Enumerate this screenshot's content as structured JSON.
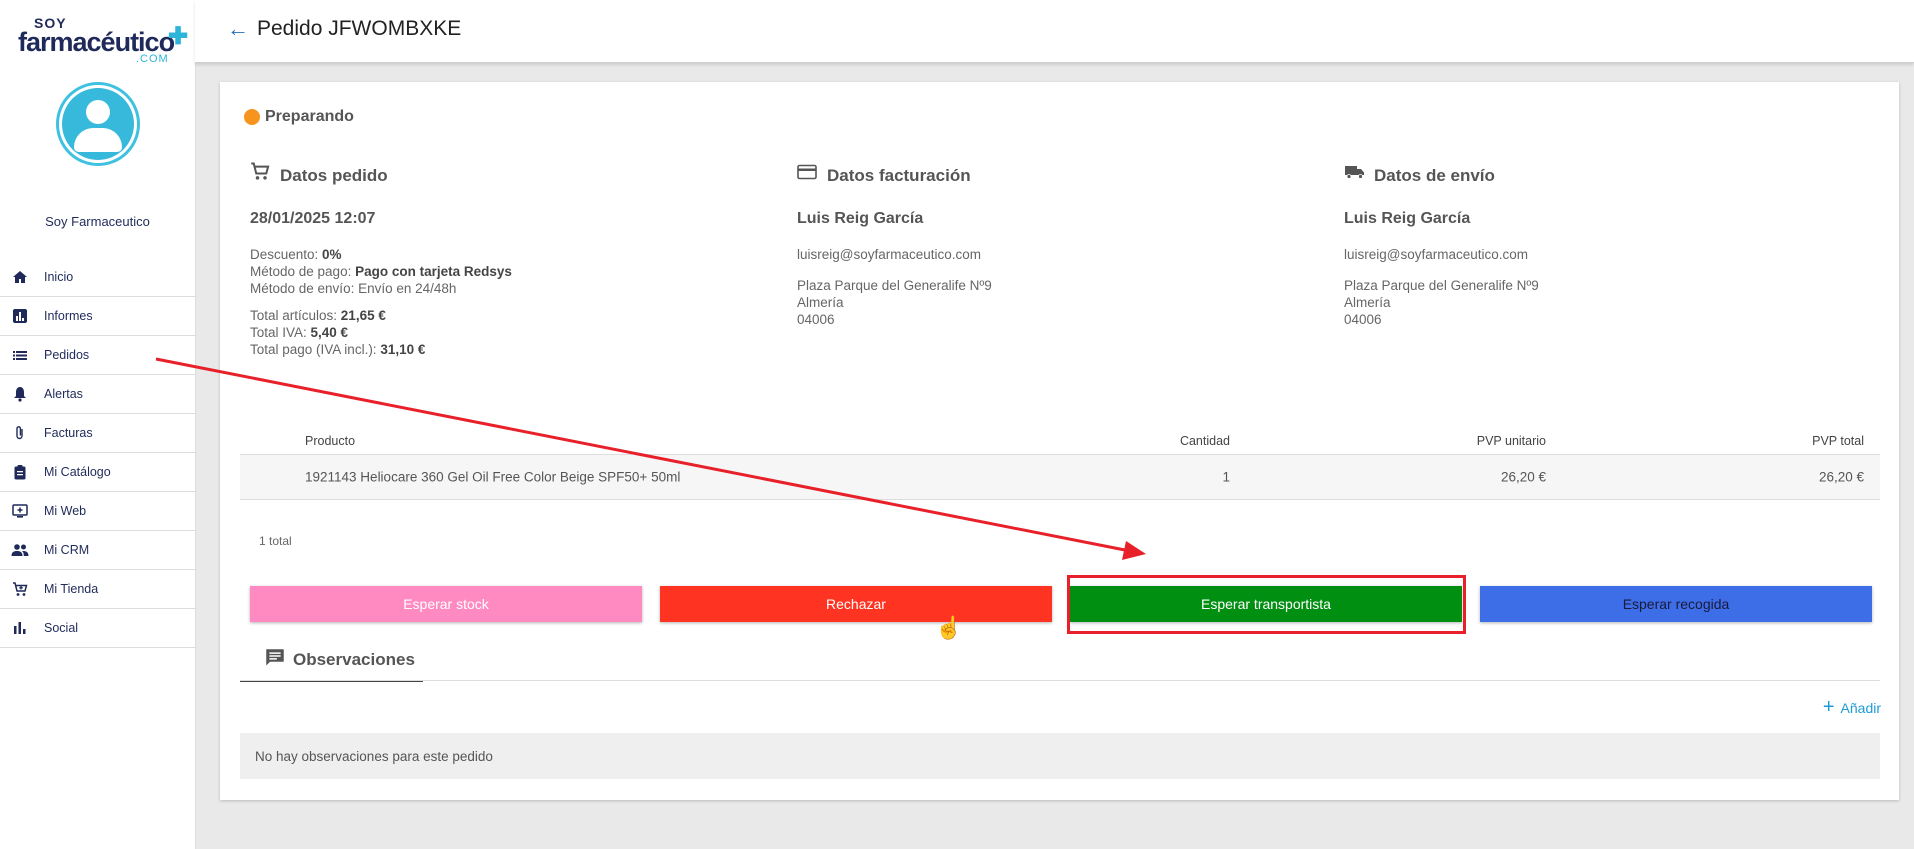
{
  "logo": {
    "line1": "SOY",
    "line2": "farmacéutico",
    "line3": ".COM"
  },
  "user": {
    "name": "Soy Farmaceutico"
  },
  "nav": {
    "items": [
      {
        "label": "Inicio",
        "icon": "home-icon"
      },
      {
        "label": "Informes",
        "icon": "chart-icon"
      },
      {
        "label": "Pedidos",
        "icon": "list-icon"
      },
      {
        "label": "Alertas",
        "icon": "bell-icon"
      },
      {
        "label": "Facturas",
        "icon": "paperclip-icon"
      },
      {
        "label": "Mi Catálogo",
        "icon": "clipboard-icon"
      },
      {
        "label": "Mi Web",
        "icon": "monitor-icon"
      },
      {
        "label": "Mi CRM",
        "icon": "people-icon"
      },
      {
        "label": "Mi Tienda",
        "icon": "cart-icon"
      },
      {
        "label": "Social",
        "icon": "bar-chart-icon"
      }
    ]
  },
  "header": {
    "title": "Pedido JFWOMBXKE"
  },
  "order": {
    "status": "Preparando",
    "status_color": "#f7941d",
    "datos_pedido": {
      "title": "Datos pedido",
      "date": "28/01/2025 12:07",
      "descuento_label": "Descuento: ",
      "descuento": "0%",
      "pago_label": "Método de pago: ",
      "pago": "Pago con tarjeta Redsys",
      "envio_line": "Método de envío: Envío en 24/48h",
      "total_articulos_label": "Total artículos: ",
      "total_articulos": "21,65 €",
      "total_iva_label": "Total IVA: ",
      "total_iva": "5,40 €",
      "total_pago_label": "Total pago (IVA incl.): ",
      "total_pago": "31,10 €"
    },
    "facturacion": {
      "title": "Datos facturación",
      "name": "Luis Reig García",
      "email": "luisreig@soyfarmaceutico.com",
      "address": "Plaza Parque del Generalife Nº9",
      "city": "Almería",
      "zip": "04006"
    },
    "envio": {
      "title": "Datos de envío",
      "name": "Luis Reig García",
      "email": "luisreig@soyfarmaceutico.com",
      "address": "Plaza Parque del Generalife Nº9",
      "city": "Almería",
      "zip": "04006"
    }
  },
  "table": {
    "headers": {
      "producto": "Producto",
      "cantidad": "Cantidad",
      "unit": "PVP unitario",
      "total": "PVP total"
    },
    "rows": [
      {
        "producto": "1921143 Heliocare 360 Gel Oil Free Color Beige SPF50+ 50ml",
        "cantidad": "1",
        "unit": "26,20 €",
        "total": "26,20 €"
      }
    ],
    "count": "1 total"
  },
  "actions": {
    "esperar_stock": "Esperar stock",
    "rechazar": "Rechazar",
    "esperar_transportista": "Esperar transportista",
    "esperar_recogida": "Esperar recogida"
  },
  "observaciones": {
    "tab": "Observaciones",
    "add": "Añadir",
    "empty": "No hay observaciones para este pedido"
  }
}
